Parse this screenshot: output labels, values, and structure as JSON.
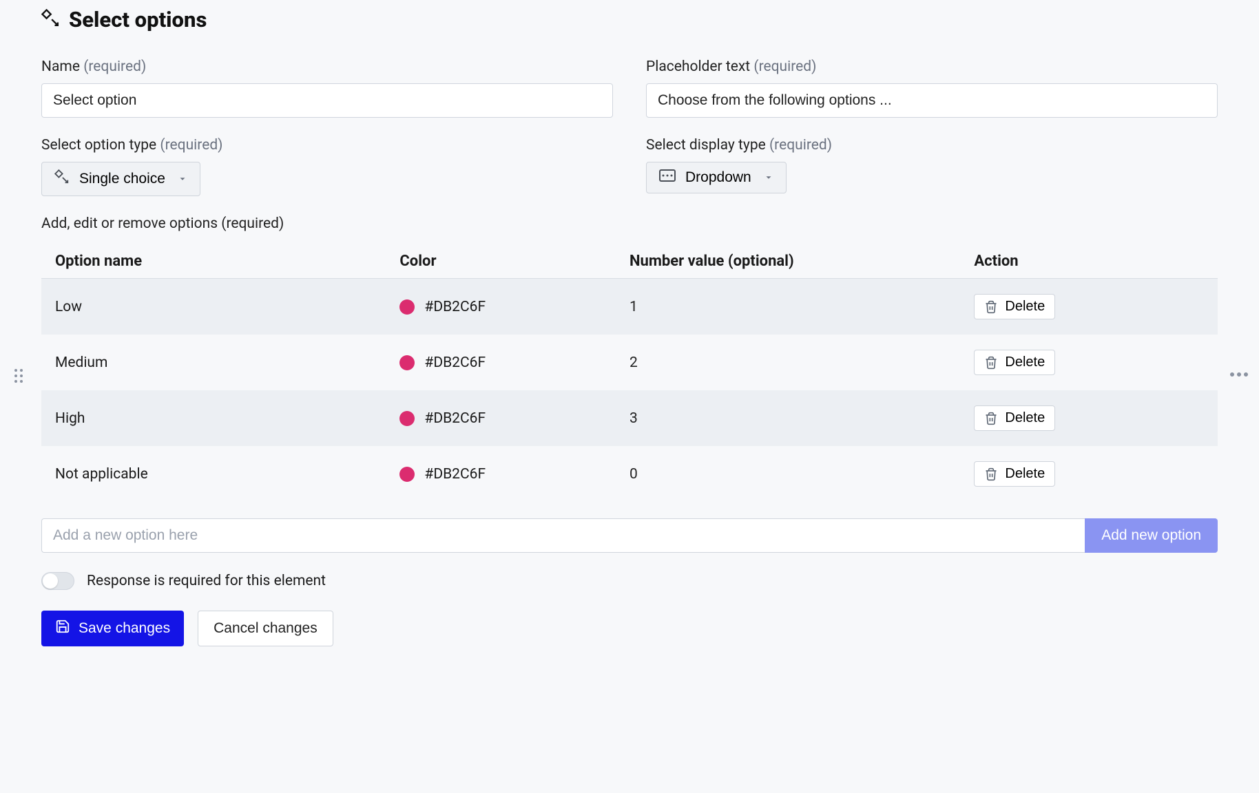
{
  "header": {
    "title": "Select options"
  },
  "labels": {
    "required": "(required)",
    "name": "Name",
    "placeholder_text": "Placeholder text",
    "option_type": "Select option type",
    "display_type": "Select display type",
    "options_section": "Add, edit or remove options"
  },
  "fields": {
    "name_value": "Select option",
    "placeholder_value": "Choose from the following options ...",
    "option_type_value": "Single choice",
    "display_type_value": "Dropdown"
  },
  "table": {
    "headers": {
      "name": "Option name",
      "color": "Color",
      "number": "Number value (optional)",
      "action": "Action"
    },
    "rows": [
      {
        "name": "Low",
        "color_hex": "#DB2C6F",
        "number": "1"
      },
      {
        "name": "Medium",
        "color_hex": "#DB2C6F",
        "number": "2"
      },
      {
        "name": "High",
        "color_hex": "#DB2C6F",
        "number": "3"
      },
      {
        "name": "Not applicable",
        "color_hex": "#DB2C6F",
        "number": "0"
      }
    ],
    "delete_label": "Delete"
  },
  "add_option": {
    "placeholder": "Add a new option here",
    "button": "Add new option"
  },
  "toggle": {
    "label": "Response is required for this element",
    "on": false
  },
  "buttons": {
    "save": "Save changes",
    "cancel": "Cancel changes"
  },
  "colors": {
    "swatch": "#DB2C6F",
    "primary": "#1414e6",
    "add_btn": "#8a94f2"
  }
}
